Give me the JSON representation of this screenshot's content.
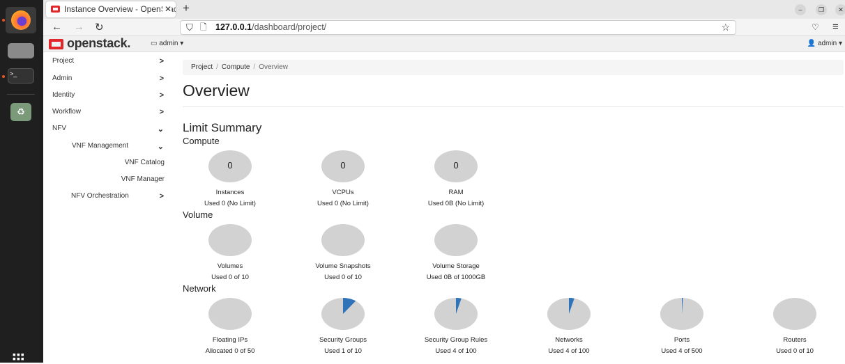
{
  "browser": {
    "tab_title": "Instance Overview - OpenStack Dashboard",
    "url_host": "127.0.0.1",
    "url_path": "/dashboard/project/"
  },
  "header": {
    "logo": "openstack.",
    "project_selector": "admin",
    "user_menu": "admin"
  },
  "sidebar": {
    "items": [
      {
        "label": "Project",
        "level": 0
      },
      {
        "label": "Admin",
        "level": 0
      },
      {
        "label": "Identity",
        "level": 0
      },
      {
        "label": "Workflow",
        "level": 0
      },
      {
        "label": "NFV",
        "level": 0,
        "expanded": true
      },
      {
        "label": "VNF Management",
        "level": 1,
        "expanded": true
      },
      {
        "label": "VNF Catalog",
        "level": 2
      },
      {
        "label": "VNF Manager",
        "level": 2
      },
      {
        "label": "NFV Orchestration",
        "level": 1
      }
    ]
  },
  "breadcrumb": [
    "Project",
    "Compute",
    "Overview"
  ],
  "page_title": "Overview",
  "limit_summary": {
    "title": "Limit Summary",
    "sections": [
      {
        "title": "Compute",
        "charts": [
          {
            "name": "Instances",
            "used_text": "Used 0 (No Limit)",
            "center": "0",
            "fraction": 0
          },
          {
            "name": "VCPUs",
            "used_text": "Used 0 (No Limit)",
            "center": "0",
            "fraction": 0
          },
          {
            "name": "RAM",
            "used_text": "Used 0B (No Limit)",
            "center": "0",
            "fraction": 0
          }
        ]
      },
      {
        "title": "Volume",
        "charts": [
          {
            "name": "Volumes",
            "used_text": "Used 0 of 10",
            "fraction": 0
          },
          {
            "name": "Volume Snapshots",
            "used_text": "Used 0 of 10",
            "fraction": 0
          },
          {
            "name": "Volume Storage",
            "used_text": "Used 0B of 1000GB",
            "fraction": 0
          }
        ]
      },
      {
        "title": "Network",
        "charts": [
          {
            "name": "Floating IPs",
            "used_text": "Allocated 0 of 50",
            "fraction": 0
          },
          {
            "name": "Security Groups",
            "used_text": "Used 1 of 10",
            "fraction": 0.1
          },
          {
            "name": "Security Group Rules",
            "used_text": "Used 4 of 100",
            "fraction": 0.04
          },
          {
            "name": "Networks",
            "used_text": "Used 4 of 100",
            "fraction": 0.04
          },
          {
            "name": "Ports",
            "used_text": "Used 4 of 500",
            "fraction": 0.008
          },
          {
            "name": "Routers",
            "used_text": "Used 0 of 10",
            "fraction": 0
          }
        ]
      }
    ]
  },
  "colors": {
    "pie_bg": "#d2d2d2",
    "pie_used": "#2f73b8",
    "logo_red": "#e0282c"
  }
}
